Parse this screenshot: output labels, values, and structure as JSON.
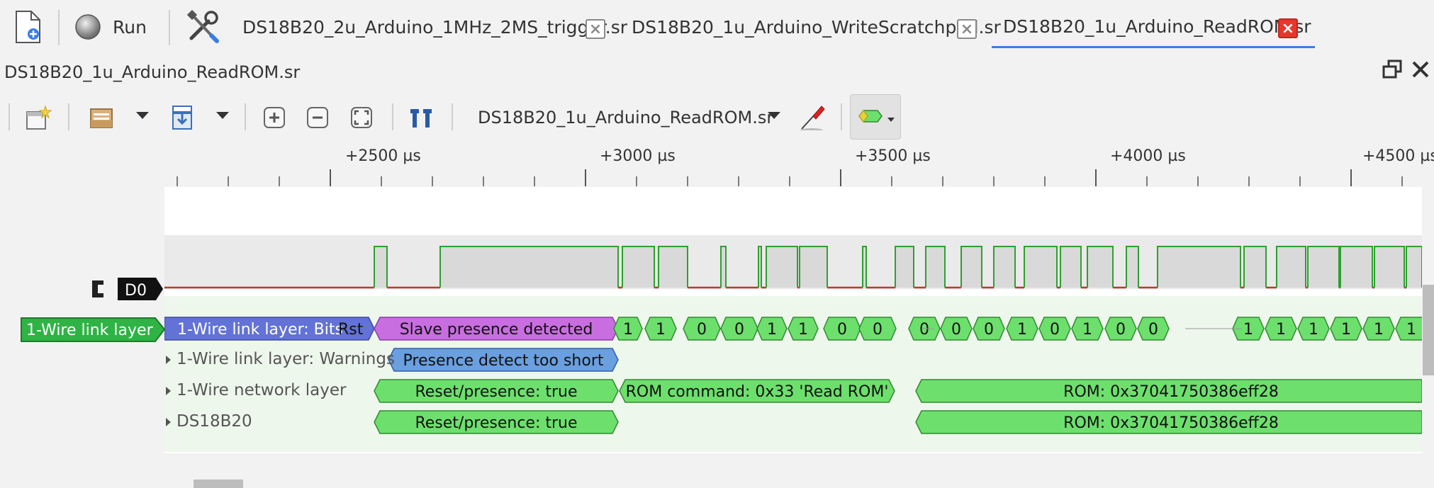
{
  "toolbar_top": {
    "run_label": "Run"
  },
  "tabs": [
    {
      "label": "DS18B20_2u_Arduino_1MHz_2MS_trigger.sr",
      "active": false
    },
    {
      "label": "DS18B20_1u_Arduino_WriteScratchpad.sr",
      "active": false
    },
    {
      "label": "DS18B20_1u_Arduino_ReadROM.sr",
      "active": true
    }
  ],
  "document": {
    "title": "DS18B20_1u_Arduino_ReadROM.sr"
  },
  "toolbar": {
    "device_select": "DS18B20_1u_Arduino_ReadROM.sr",
    "icons": [
      "new-view-icon",
      "open-file-icon",
      "save-file-icon",
      "zoom-in-icon",
      "zoom-out-icon",
      "zoom-fit-icon",
      "cursor-icon",
      "probe-icon",
      "decoder-icon"
    ]
  },
  "ruler": {
    "labels": [
      "+2500 µs",
      "+3000 µs",
      "+3500 µs",
      "+4000 µs",
      "+4500 µs"
    ]
  },
  "channels": {
    "decoder_badge": "1-Wire link layer",
    "digital_badge": "D0"
  },
  "rows": {
    "warnings": "1-Wire link layer: Warnings",
    "network": "1-Wire network layer",
    "device": "DS18B20"
  },
  "annotations": {
    "bits_label": "1-Wire link layer: Bits",
    "rst": "Rst",
    "slave_presence": "Slave presence detected",
    "bits": [
      "1",
      "1",
      "0",
      "0",
      "1",
      "1",
      "0",
      "0",
      "0",
      "0",
      "0",
      "1",
      "0",
      "1",
      "0",
      "0",
      "1",
      "1",
      "1",
      "1",
      "1",
      "1"
    ],
    "presence_short": "Presence detect too short",
    "net_reset": "Reset/presence: true",
    "rom_command": "ROM command: 0x33 'Read ROM'",
    "rom_value": "ROM: 0x37041750386eff28",
    "dev_reset": "Reset/presence: true",
    "dev_rom": "ROM: 0x37041750386eff28"
  },
  "colors": {
    "green_fill": "#6ddf6d",
    "green_stroke": "#2f8a2f",
    "purple_fill": "#c86ee0",
    "blue_fill": "#6a9fe0",
    "bits_fill": "#6272d6",
    "signal_high": "#2ea02e",
    "signal_low": "#c0392b",
    "tab_accent": "#3b7de3",
    "close_red": "#e8362c"
  }
}
